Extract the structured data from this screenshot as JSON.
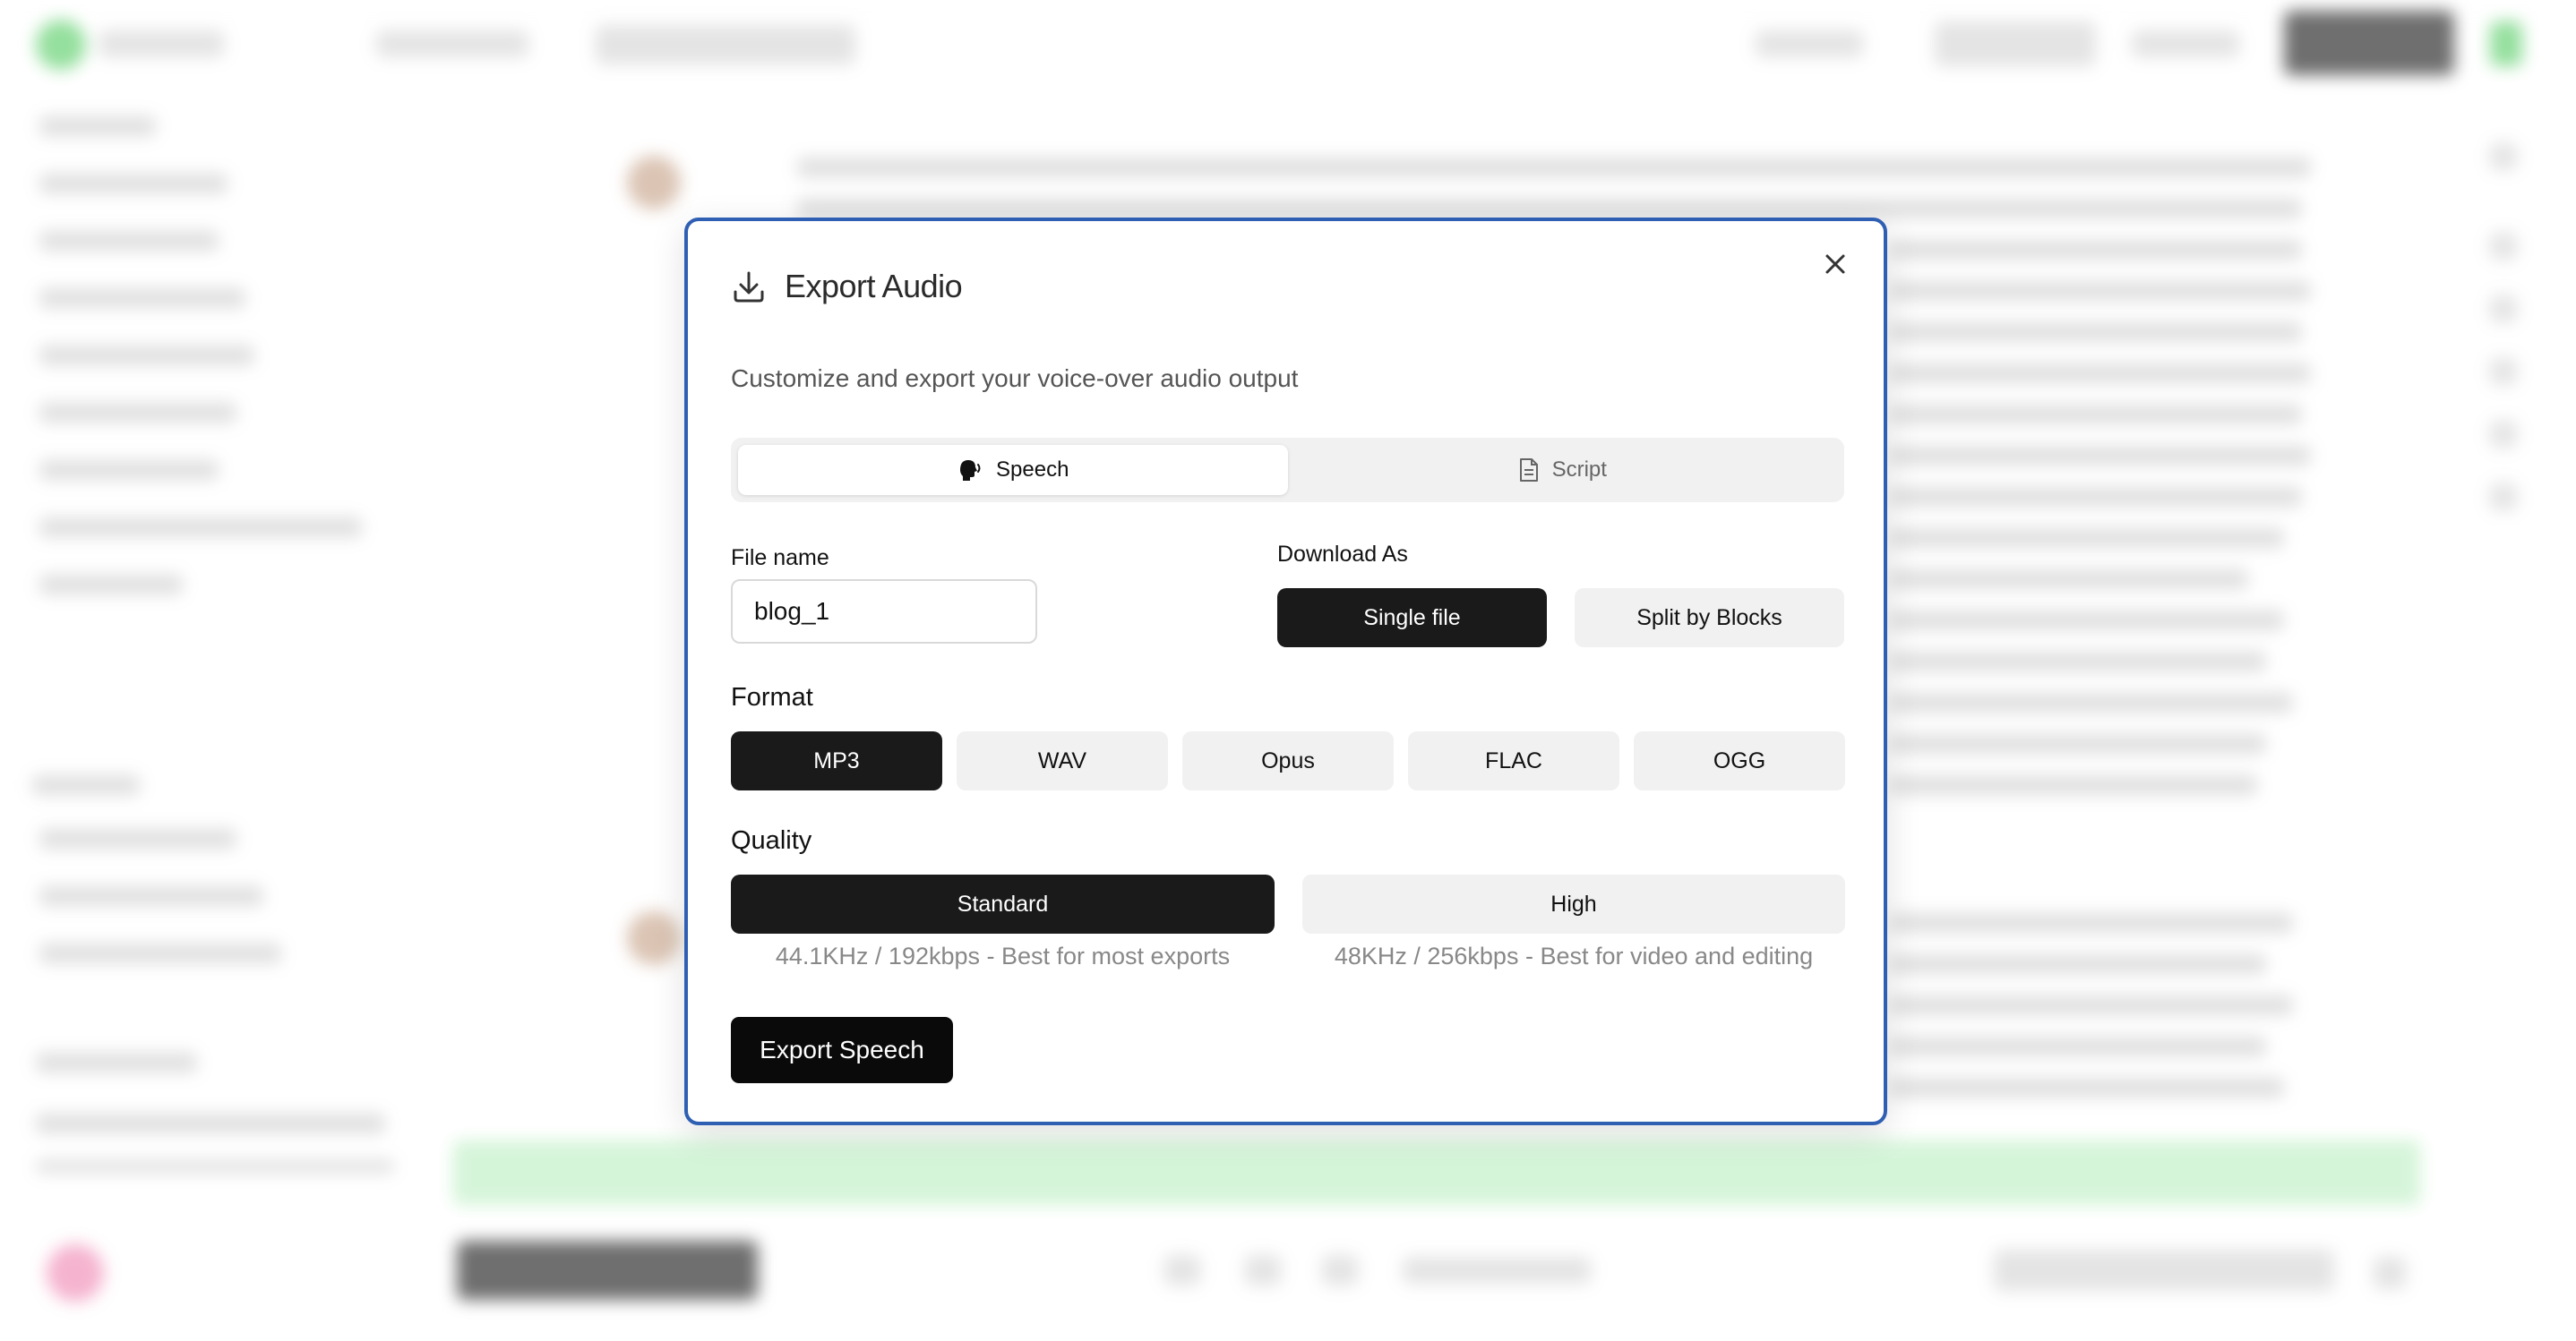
{
  "modal": {
    "title": "Export Audio",
    "subtitle": "Customize and export your voice-over audio output",
    "close_icon": "close-icon",
    "tabs": [
      {
        "label": "Speech",
        "icon": "speaking-head-icon",
        "active": true
      },
      {
        "label": "Script",
        "icon": "document-icon",
        "active": false
      }
    ],
    "file_name": {
      "label": "File name",
      "value": "blog_1"
    },
    "download_as": {
      "label": "Download As",
      "options": [
        {
          "label": "Single file",
          "selected": true
        },
        {
          "label": "Split by Blocks",
          "selected": false
        }
      ]
    },
    "format": {
      "label": "Format",
      "options": [
        {
          "label": "MP3",
          "selected": true
        },
        {
          "label": "WAV",
          "selected": false
        },
        {
          "label": "Opus",
          "selected": false
        },
        {
          "label": "FLAC",
          "selected": false
        },
        {
          "label": "OGG",
          "selected": false
        }
      ]
    },
    "quality": {
      "label": "Quality",
      "options": [
        {
          "label": "Standard",
          "note": "44.1KHz / 192kbps - Best for most exports",
          "selected": true
        },
        {
          "label": "High",
          "note": "48KHz / 256kbps - Best for video and editing",
          "selected": false
        }
      ]
    },
    "export_button": "Export Speech"
  },
  "colors": {
    "modal_border": "#2f5fb3",
    "selected_button": "#1a1a1a",
    "unselected_button": "#f1f1f1"
  }
}
